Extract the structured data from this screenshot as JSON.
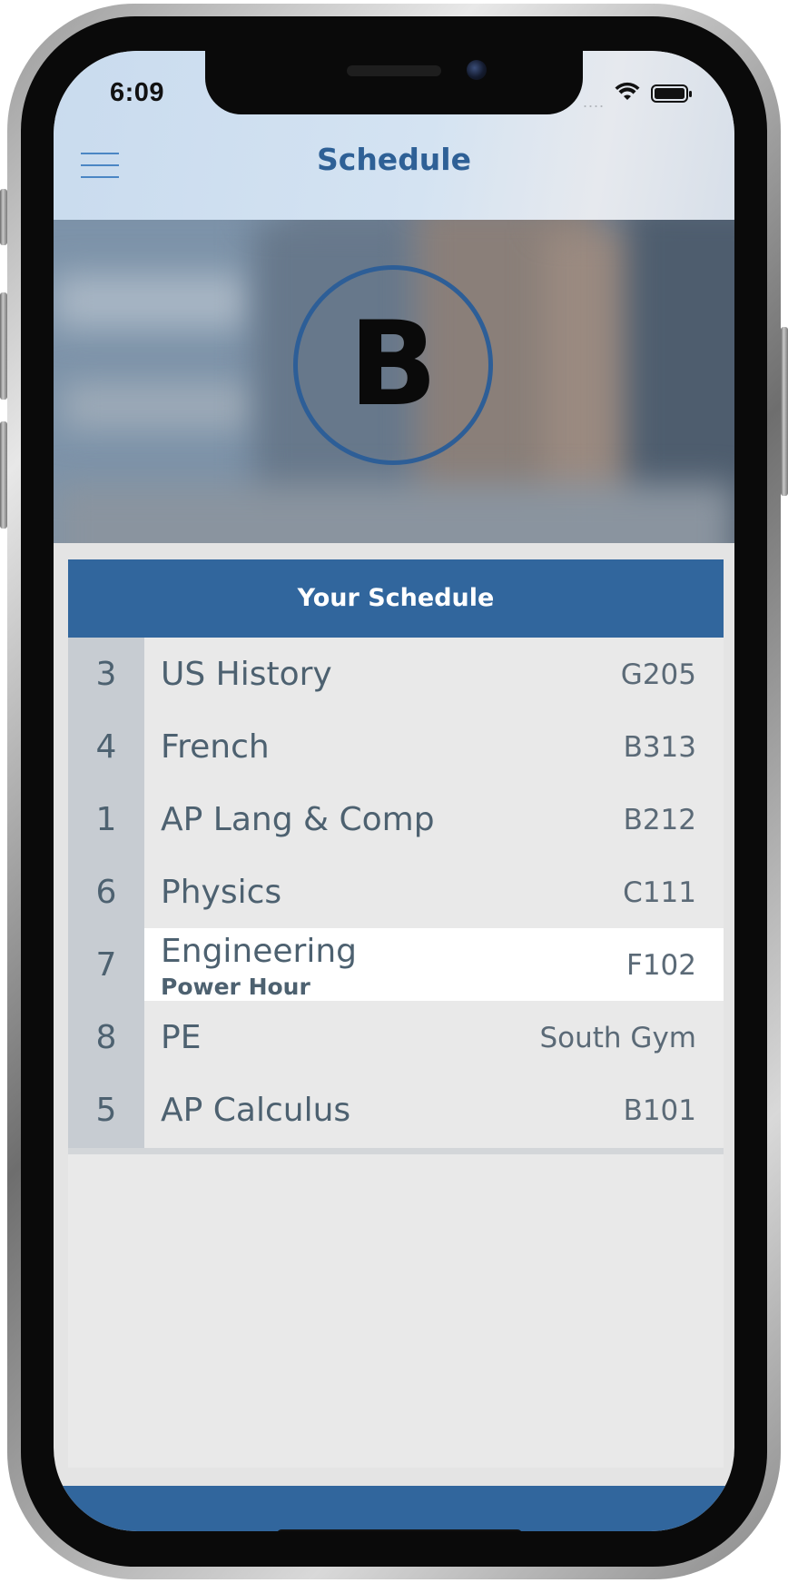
{
  "status_bar": {
    "time": "6:09",
    "signal": "....",
    "wifi_icon": "wifi-icon",
    "battery_icon": "battery-icon"
  },
  "header": {
    "menu_icon": "hamburger-menu-icon",
    "title": "Schedule"
  },
  "hero": {
    "day_letter": "B",
    "accent_color": "#2d5e97"
  },
  "schedule": {
    "header": "Your Schedule",
    "header_color": "#31669d",
    "rows": [
      {
        "period": "3",
        "course": "US History",
        "room": "G205",
        "active": false
      },
      {
        "period": "4",
        "course": "French",
        "room": "B313",
        "active": false
      },
      {
        "period": "1",
        "course": "AP Lang & Comp",
        "room": "B212",
        "active": false
      },
      {
        "period": "6",
        "course": "Physics",
        "room": "C111",
        "active": false
      },
      {
        "period": "7",
        "course": "Engineering",
        "subtitle": "Power Hour",
        "room": "F102",
        "active": true
      },
      {
        "period": "8",
        "course": "PE",
        "room": "South Gym",
        "active": false
      },
      {
        "period": "5",
        "course": "AP Calculus",
        "room": "B101",
        "active": false
      }
    ]
  }
}
